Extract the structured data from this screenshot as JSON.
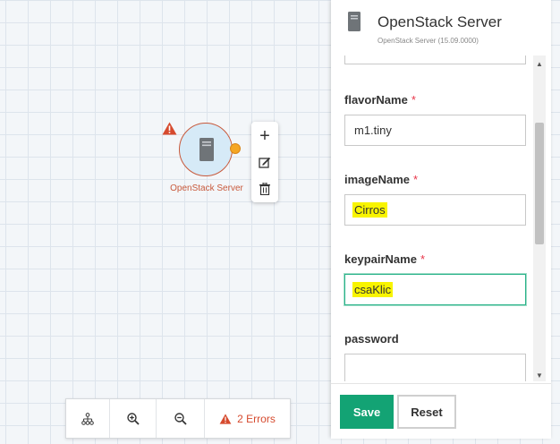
{
  "canvas": {
    "node": {
      "label": "OpenStack Server",
      "icon": "server-icon",
      "status_icon": "warning-icon",
      "accent_color": "#c8593b",
      "fill_color": "#d6eaf7",
      "port_color": "#f5a623"
    },
    "node_toolbar": {
      "icons": [
        "plus-icon",
        "edit-icon",
        "trash-icon"
      ]
    }
  },
  "bottom_toolbar": {
    "icons": [
      "hierarchy-icon",
      "zoom-in-icon",
      "zoom-out-icon",
      "warning-icon"
    ],
    "errors_label": "2 Errors",
    "error_color": "#d64a2e"
  },
  "panel": {
    "title": "OpenStack Server",
    "subtitle": "OpenStack Server (15.09.0000)",
    "icon": "server-icon",
    "fields": [
      {
        "label": "flavorName",
        "required_mark": "*",
        "value": "m1.tiny",
        "highlighted": false
      },
      {
        "label": "imageName",
        "required_mark": "*",
        "value": "Cirros",
        "highlighted": true
      },
      {
        "label": "keypairName",
        "required_mark": "*",
        "value": "csaKlic",
        "highlighted": true,
        "focused": true
      },
      {
        "label": "password",
        "required_mark": "",
        "value": ""
      }
    ],
    "save_label": "Save",
    "reset_label": "Reset",
    "save_color": "#13a374",
    "focus_color": "#2ab38a",
    "highlight_color": "#f8f400"
  }
}
